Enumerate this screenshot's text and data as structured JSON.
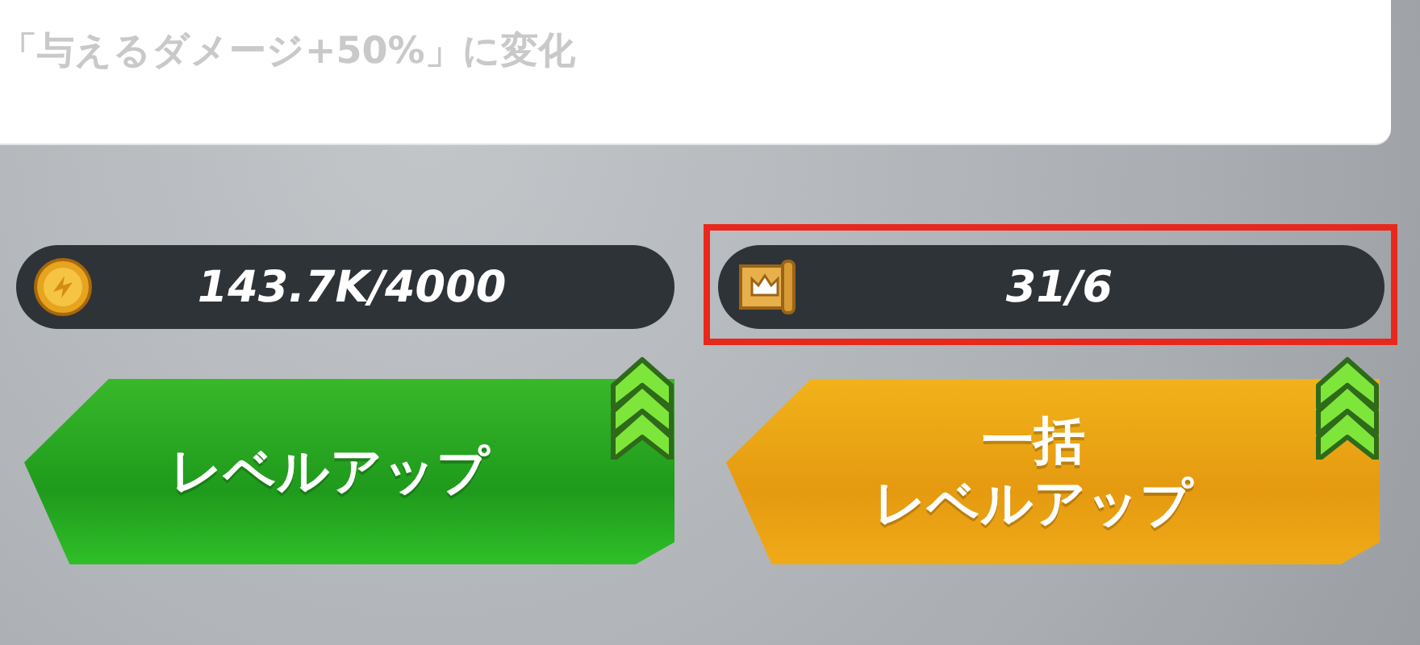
{
  "description": {
    "text": "「与えるダメージ+50%」に変化"
  },
  "resources": [
    {
      "kind": "coin",
      "amount": "143.7K/4000",
      "highlighted": false
    },
    {
      "kind": "scroll",
      "amount": "31/6",
      "highlighted": true
    }
  ],
  "buttons": [
    {
      "kind": "green",
      "lines": [
        "レベルアップ"
      ]
    },
    {
      "kind": "orange",
      "lines": [
        "一括",
        "レベルアップ"
      ]
    }
  ]
}
